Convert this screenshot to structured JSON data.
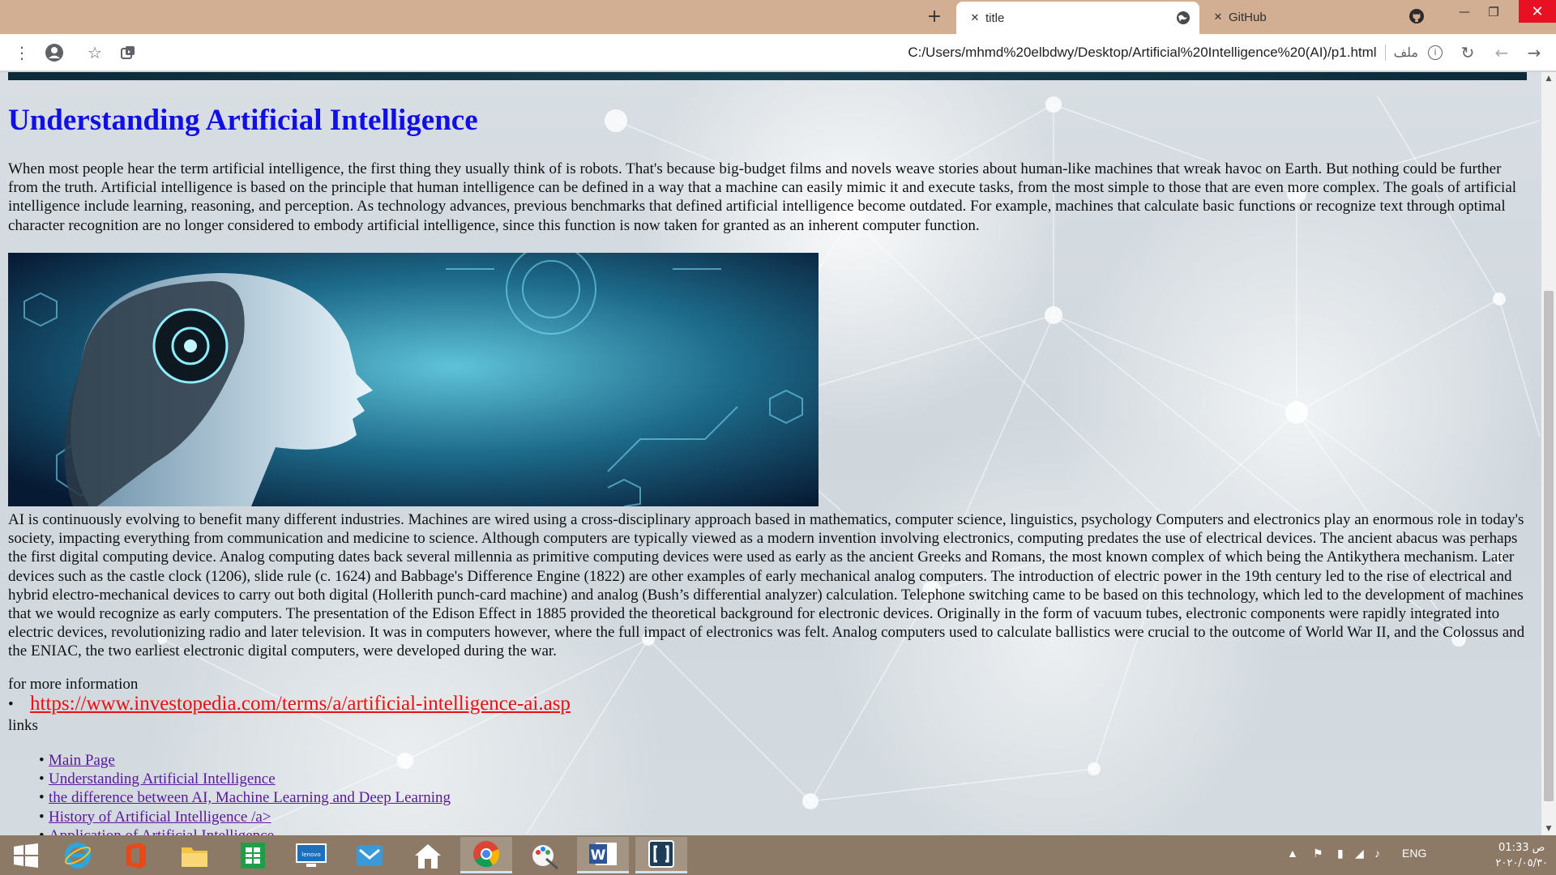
{
  "browser": {
    "tabs": [
      {
        "label": "title",
        "active": true
      },
      {
        "label": "GitHub",
        "active": false
      }
    ],
    "address": {
      "url": "C:/Users/mhmd%20elbdwy/Desktop/Artificial%20Intelligence%20(AI)/p1.html",
      "scheme_chip": "ملف"
    },
    "icons": [
      "menu-icon",
      "profile-icon",
      "star-icon",
      "extension-icon",
      "reload-icon",
      "back-arrow-icon",
      "forward-arrow-icon",
      "github-icon",
      "globe-icon",
      "plus-icon",
      "close-icon"
    ]
  },
  "page": {
    "title": "Understanding Artificial Intelligence",
    "para1": "When most people hear the term artificial intelligence, the first thing they usually think of is robots. That's because big-budget films and novels weave stories about human-like machines that wreak havoc on Earth. But nothing could be further from the truth. Artificial intelligence is based on the principle that human intelligence can be defined in a way that a machine can easily mimic it and execute tasks, from the most simple to those that are even more complex. The goals of artificial intelligence include learning, reasoning, and perception. As technology advances, previous benchmarks that defined artificial intelligence become outdated. For example, machines that calculate basic functions or recognize text through optimal character recognition are no longer considered to embody artificial intelligence, since this function is now taken for granted as an inherent computer function.",
    "para2": "AI is continuously evolving to benefit many different industries. Machines are wired using a cross-disciplinary approach based in mathematics, computer science, linguistics, psychology Computers and electronics play an enormous role in today's society, impacting everything from communication and medicine to science. Although computers are typically viewed as a modern invention involving electronics, computing predates the use of electrical devices. The ancient abacus was perhaps the first digital computing device. Analog computing dates back several millennia as primitive computing devices were used as early as the ancient Greeks and Romans, the most known complex of which being the Antikythera mechanism. Later devices such as the castle clock (1206), slide rule (c. 1624) and Babbage's Difference Engine (1822) are other examples of early mechanical analog computers. The introduction of electric power in the 19th century led to the rise of electrical and hybrid electro-mechanical devices to carry out both digital (Hollerith punch-card machine) and analog (Bush’s differential analyzer) calculation. Telephone switching came to be based on this technology, which led to the development of machines that we would recognize as early computers. The presentation of the Edison Effect in 1885 provided the theoretical background for electronic devices. Originally in the form of vacuum tubes, electronic components were rapidly integrated into electric devices, revolutionizing radio and later television. It was in computers however, where the full impact of electronics was felt. Analog computers used to calculate ballistics were crucial to the outcome of World War II, and the Colossus and the ENIAC, the two earliest electronic digital computers, were developed during the war.",
    "more_info_label": "for more information",
    "info_link": "https://www.investopedia.com/terms/a/artificial-intelligence-ai.asp",
    "links_label": "links",
    "nav_links": [
      "Main Page",
      "Understanding Artificial Intelligence",
      "the difference between AI, Machine Learning and Deep Learning",
      "History of Artificial Intelligence /a>",
      "Application of Artificial Intelligence"
    ]
  },
  "taskbar": {
    "apps": [
      "windows-start-icon",
      "internet-explorer-icon",
      "office-icon",
      "file-explorer-icon",
      "spreadsheet-icon",
      "lenovo-app-icon",
      "mail-icon",
      "home-icon",
      "chrome-icon",
      "paint-icon",
      "word-icon",
      "bracket-app-icon"
    ],
    "language": "ENG",
    "time": "01:33 ص",
    "date": "٢٠٢٠/٠٥/٣٠"
  },
  "colors": {
    "tabbar": "#d2ae92",
    "title_blue": "#1010e6",
    "info_link_red": "#e81010",
    "nav_link_purple": "#5a189a",
    "taskbar": "#8d7a66"
  }
}
